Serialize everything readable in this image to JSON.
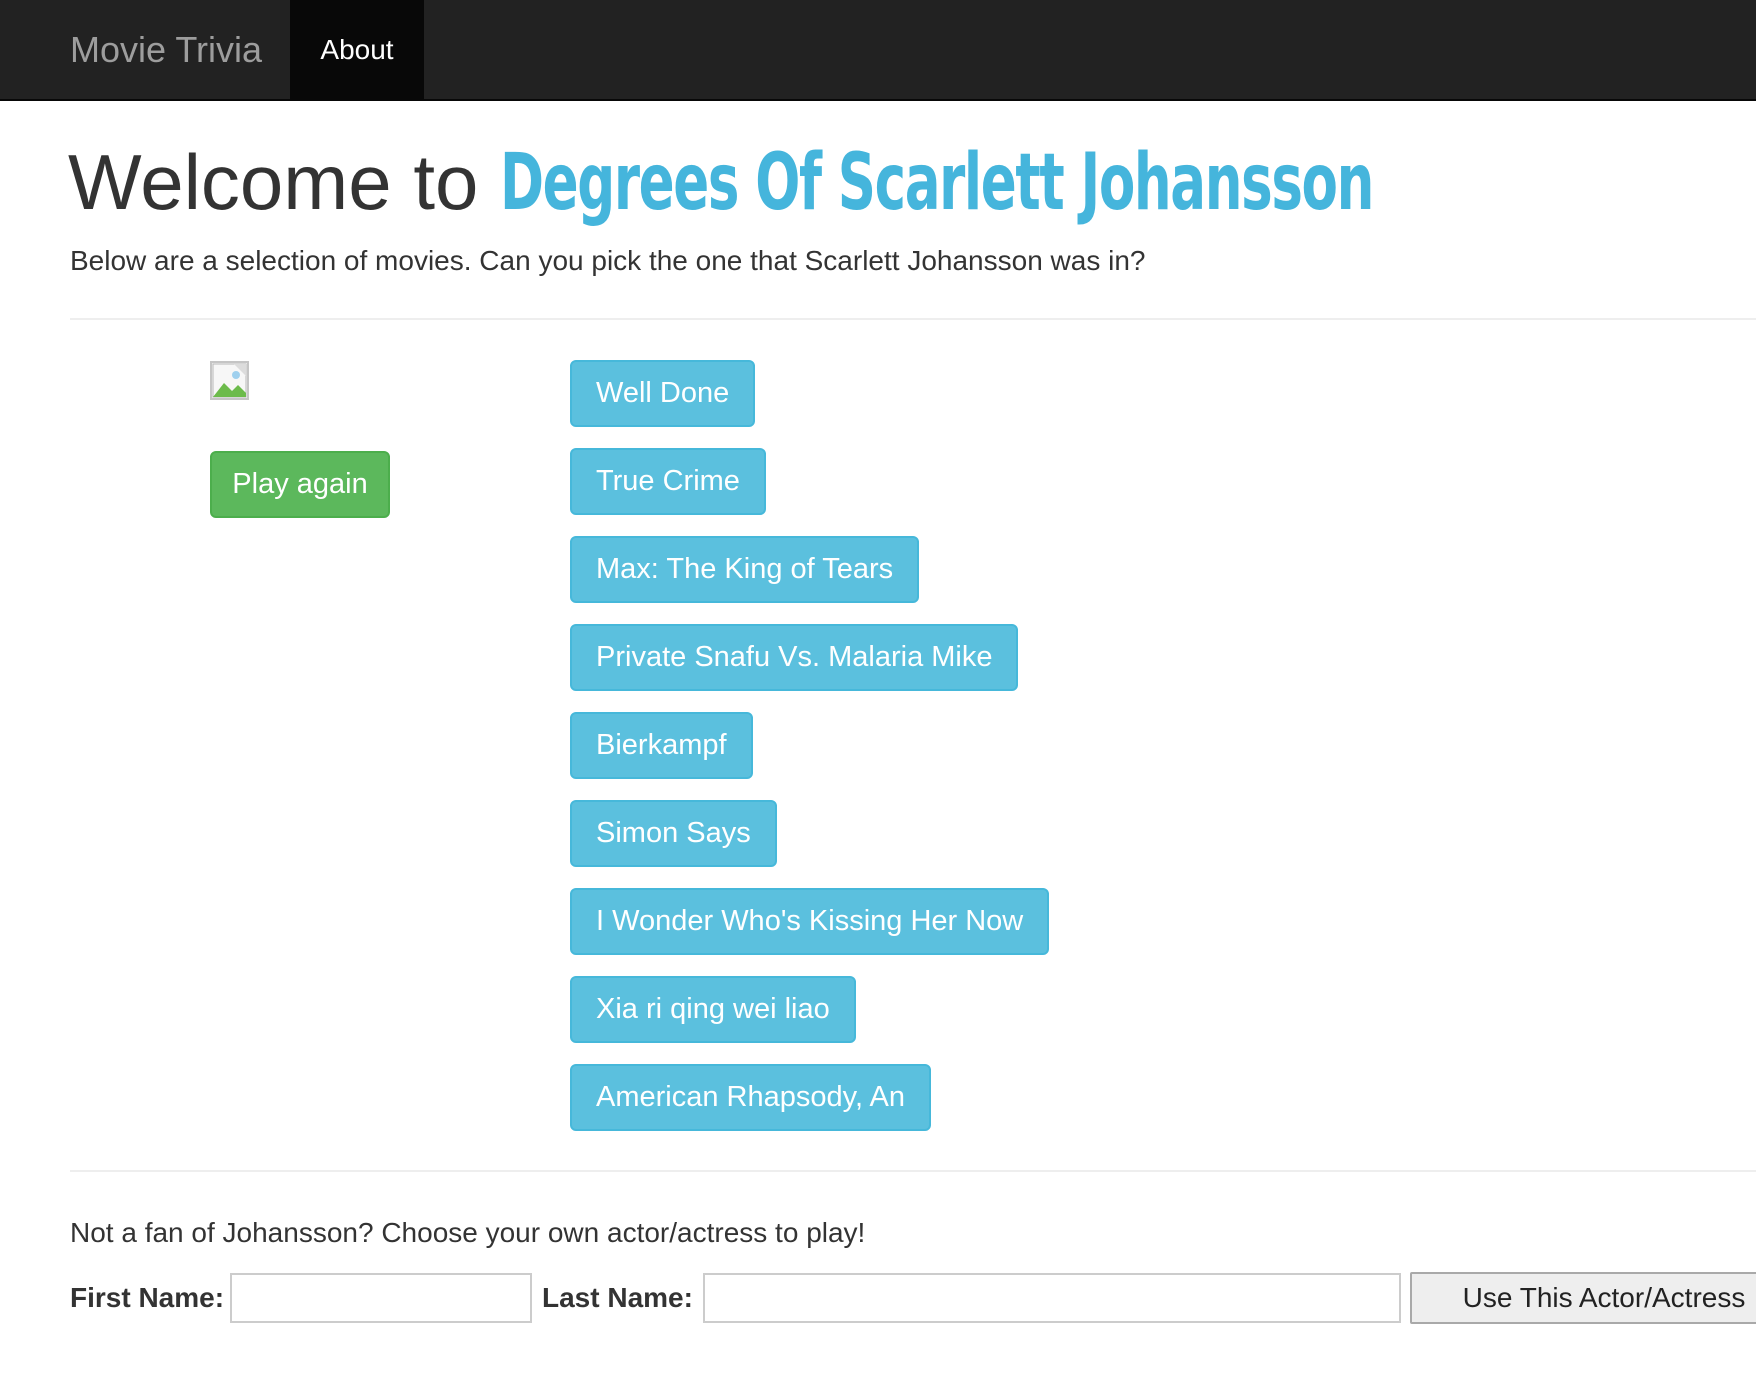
{
  "navbar": {
    "brand": "Movie Trivia",
    "about_label": "About"
  },
  "header": {
    "welcome_prefix": "Welcome to",
    "game_name": "Degrees Of Scarlett Johansson",
    "intro": "Below are a selection of movies. Can you pick the one that Scarlett Johansson was in?"
  },
  "left_panel": {
    "image_icon": "broken-image-icon",
    "play_again_label": "Play again"
  },
  "movies": [
    "Well Done",
    "True Crime",
    "Max: The King of Tears",
    "Private Snafu Vs. Malaria Mike",
    "Bierkampf",
    "Simon Says",
    "I Wonder Who's Kissing Her Now",
    "Xia ri qing wei liao",
    "American Rhapsody, An"
  ],
  "actor_form": {
    "prompt": "Not a fan of Johansson? Choose your own actor/actress to play!",
    "first_name_label": "First Name:",
    "first_name_value": "",
    "last_name_label": "Last Name:",
    "last_name_value": "",
    "submit_label": "Use This Actor/Actress"
  },
  "colors": {
    "navbar_bg": "#222222",
    "accent_title": "#45b5dc",
    "movie_button": "#5bc0de",
    "play_button": "#5cb85c"
  }
}
